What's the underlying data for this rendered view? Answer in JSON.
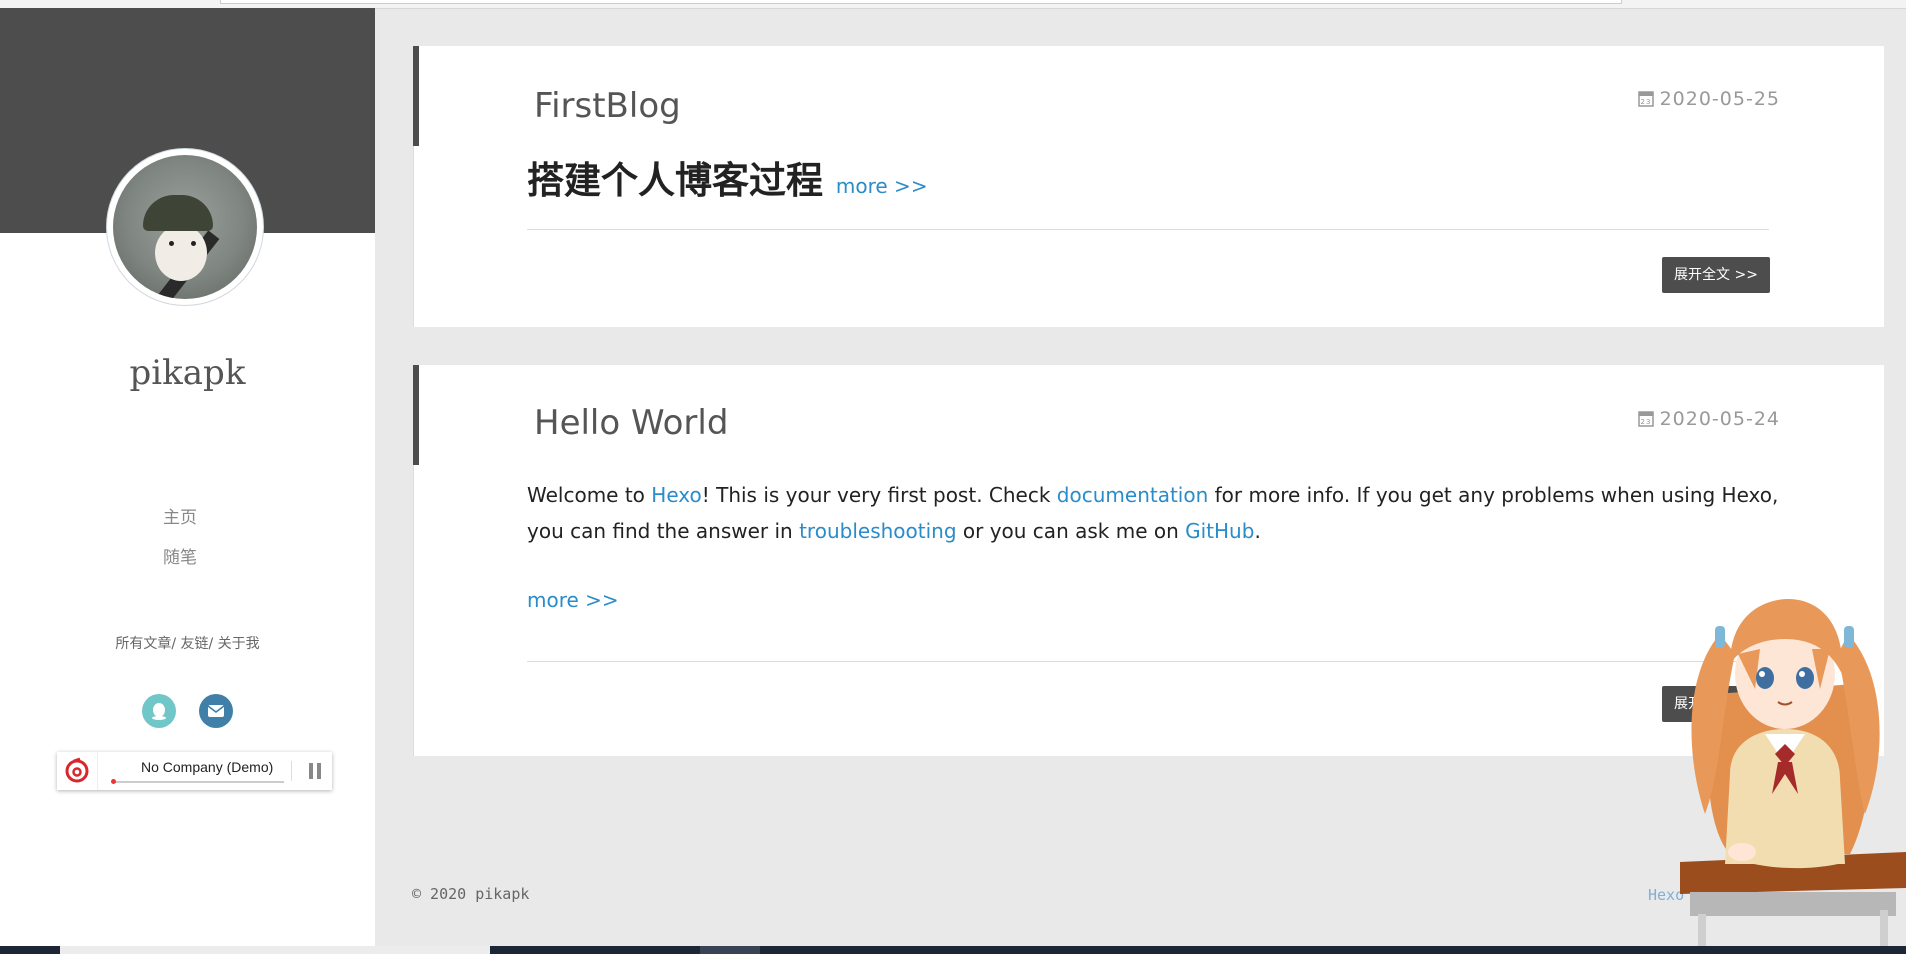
{
  "sidebar": {
    "site_name": "pikapk",
    "nav": [
      {
        "label": "主页"
      },
      {
        "label": "随笔"
      }
    ],
    "links": [
      "所有文章",
      "友链",
      "关于我"
    ],
    "link_separator": "/",
    "socials": [
      {
        "name": "qq",
        "icon": "qq-icon",
        "color": "#71c6c8"
      },
      {
        "name": "mail",
        "icon": "mail-icon",
        "color": "#3f7fa8"
      }
    ],
    "player": {
      "song": "No Company (Demo)",
      "state": "playing",
      "progress": 0.01
    }
  },
  "posts": [
    {
      "title": "FirstBlog",
      "date": "2020-05-25",
      "excerpt_heading": "搭建个人博客过程",
      "more": "more >>",
      "readmore": "展开全文 >>"
    },
    {
      "title": "Hello World",
      "date": "2020-05-24",
      "body": {
        "t1": "Welcome to ",
        "l1": "Hexo",
        "t2": "! This is your very first post. Check ",
        "l2": "documentation",
        "t3": " for more info. If you get any problems when using Hexo, you can find the answer in ",
        "l3": "troubleshooting",
        "t4": " or you can ask me on ",
        "l4": "GitHub",
        "t5": "."
      },
      "more": "more >>",
      "readmore": "展开全文 >>"
    }
  ],
  "footer": {
    "copyright": "© 2020 pikapk",
    "powered": "Hexo"
  },
  "colors": {
    "accent": "#4d4d4d",
    "link": "#2a8cc9",
    "background": "#e9e9e9"
  }
}
